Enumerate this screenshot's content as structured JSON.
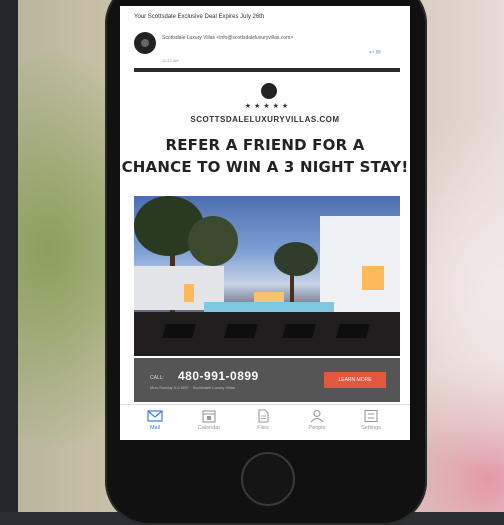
{
  "email": {
    "subject": "Your Scottsdale Exclusive Deal Expires July 26th",
    "sender": "Scottsdale Luxury Villas <info@scottsdaleluxuryvillas.com>",
    "time": "11:32 AM",
    "reply_icon": "reply-icon"
  },
  "promo": {
    "stars": "★★★★★",
    "site": "SCOTTSDALELUXURYVILLAS.COM",
    "headline_line1": "REFER A FRIEND FOR A",
    "headline_line2": "CHANCE TO WIN A 3 NIGHT STAY!"
  },
  "contact": {
    "call_label": "CALL:",
    "phone": "480-991-0899",
    "hours": "Mon-Sunday 9-6 MST · Scottsdale Luxury Villas",
    "button": "LEARN MORE",
    "button_color": "#e2573e"
  },
  "nav": {
    "items": [
      {
        "label": "Mail",
        "icon": "mail-icon",
        "active": true
      },
      {
        "label": "Calendar",
        "icon": "calendar-icon"
      },
      {
        "label": "Files",
        "icon": "files-icon"
      },
      {
        "label": "People",
        "icon": "people-icon"
      },
      {
        "label": "Settings",
        "icon": "settings-icon"
      }
    ],
    "active_color": "#3d7bd6"
  }
}
